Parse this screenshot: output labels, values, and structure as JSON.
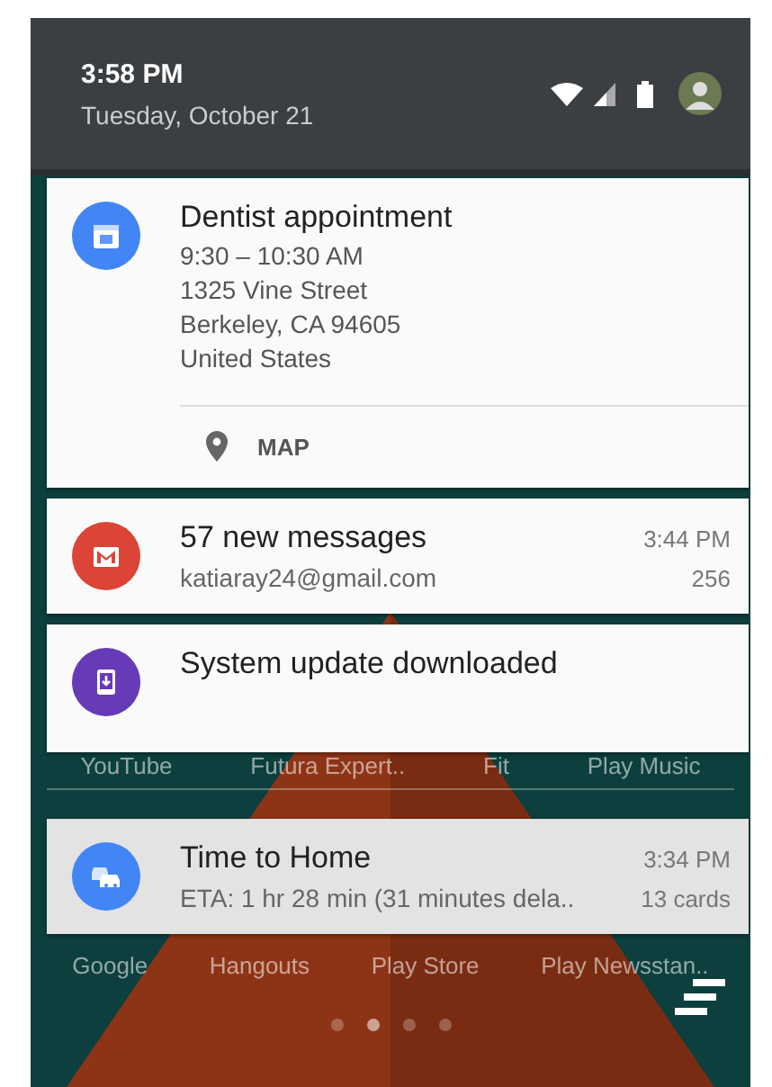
{
  "status_bar": {
    "time": "3:58 PM",
    "date": "Tuesday, October 21"
  },
  "notifications": [
    {
      "kind": "event",
      "color": "#4285f4",
      "title": "Dentist appointment",
      "lines": [
        "9:30 – 10:30 AM",
        "1325 Vine Street",
        "Berkeley, CA 94605",
        "United States"
      ],
      "action": "MAP"
    },
    {
      "kind": "mail",
      "color": "#db4437",
      "title": "57 new messages",
      "subtitle": "katiaray24@gmail.com",
      "time": "3:44 PM",
      "count": "256"
    },
    {
      "kind": "update",
      "color": "#673ab7",
      "title": "System update downloaded"
    }
  ],
  "home_apps_row_1": [
    "YouTube",
    "Futura Expert..",
    "Fit",
    "Play Music"
  ],
  "traffic_card": {
    "kind": "traffic",
    "color": "#4285f4",
    "title": "Time to Home",
    "subtitle": "ETA: 1 hr 28 min (31 minutes dela..",
    "time": "3:34 PM",
    "count": "13 cards"
  },
  "home_apps_row_2": [
    "Google",
    "Hangouts",
    "Play Store",
    "Play Newsstan.."
  ],
  "page_dots": [
    {
      "selected": false
    },
    {
      "selected": true
    },
    {
      "selected": false
    },
    {
      "selected": false
    }
  ]
}
